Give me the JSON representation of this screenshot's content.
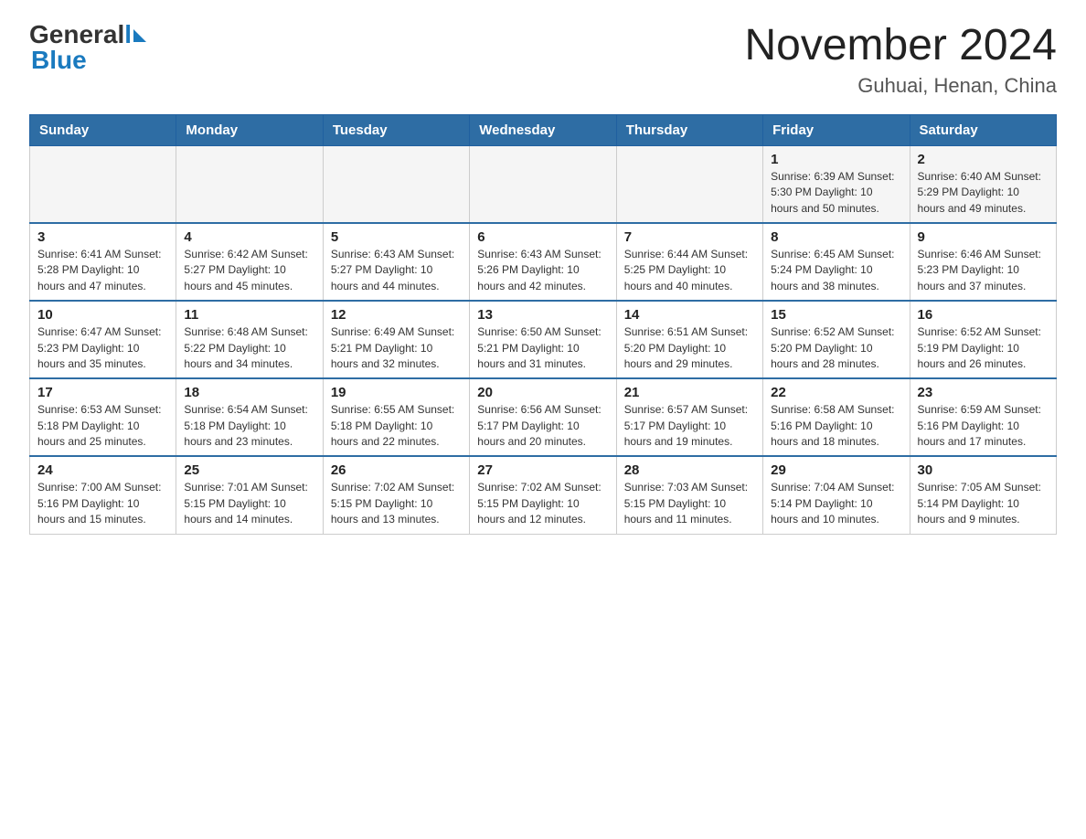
{
  "header": {
    "logo_general": "General",
    "logo_blue": "Blue",
    "title": "November 2024",
    "subtitle": "Guhuai, Henan, China"
  },
  "days_of_week": [
    "Sunday",
    "Monday",
    "Tuesday",
    "Wednesday",
    "Thursday",
    "Friday",
    "Saturday"
  ],
  "weeks": [
    [
      {
        "day": "",
        "info": ""
      },
      {
        "day": "",
        "info": ""
      },
      {
        "day": "",
        "info": ""
      },
      {
        "day": "",
        "info": ""
      },
      {
        "day": "",
        "info": ""
      },
      {
        "day": "1",
        "info": "Sunrise: 6:39 AM\nSunset: 5:30 PM\nDaylight: 10 hours and 50 minutes."
      },
      {
        "day": "2",
        "info": "Sunrise: 6:40 AM\nSunset: 5:29 PM\nDaylight: 10 hours and 49 minutes."
      }
    ],
    [
      {
        "day": "3",
        "info": "Sunrise: 6:41 AM\nSunset: 5:28 PM\nDaylight: 10 hours and 47 minutes."
      },
      {
        "day": "4",
        "info": "Sunrise: 6:42 AM\nSunset: 5:27 PM\nDaylight: 10 hours and 45 minutes."
      },
      {
        "day": "5",
        "info": "Sunrise: 6:43 AM\nSunset: 5:27 PM\nDaylight: 10 hours and 44 minutes."
      },
      {
        "day": "6",
        "info": "Sunrise: 6:43 AM\nSunset: 5:26 PM\nDaylight: 10 hours and 42 minutes."
      },
      {
        "day": "7",
        "info": "Sunrise: 6:44 AM\nSunset: 5:25 PM\nDaylight: 10 hours and 40 minutes."
      },
      {
        "day": "8",
        "info": "Sunrise: 6:45 AM\nSunset: 5:24 PM\nDaylight: 10 hours and 38 minutes."
      },
      {
        "day": "9",
        "info": "Sunrise: 6:46 AM\nSunset: 5:23 PM\nDaylight: 10 hours and 37 minutes."
      }
    ],
    [
      {
        "day": "10",
        "info": "Sunrise: 6:47 AM\nSunset: 5:23 PM\nDaylight: 10 hours and 35 minutes."
      },
      {
        "day": "11",
        "info": "Sunrise: 6:48 AM\nSunset: 5:22 PM\nDaylight: 10 hours and 34 minutes."
      },
      {
        "day": "12",
        "info": "Sunrise: 6:49 AM\nSunset: 5:21 PM\nDaylight: 10 hours and 32 minutes."
      },
      {
        "day": "13",
        "info": "Sunrise: 6:50 AM\nSunset: 5:21 PM\nDaylight: 10 hours and 31 minutes."
      },
      {
        "day": "14",
        "info": "Sunrise: 6:51 AM\nSunset: 5:20 PM\nDaylight: 10 hours and 29 minutes."
      },
      {
        "day": "15",
        "info": "Sunrise: 6:52 AM\nSunset: 5:20 PM\nDaylight: 10 hours and 28 minutes."
      },
      {
        "day": "16",
        "info": "Sunrise: 6:52 AM\nSunset: 5:19 PM\nDaylight: 10 hours and 26 minutes."
      }
    ],
    [
      {
        "day": "17",
        "info": "Sunrise: 6:53 AM\nSunset: 5:18 PM\nDaylight: 10 hours and 25 minutes."
      },
      {
        "day": "18",
        "info": "Sunrise: 6:54 AM\nSunset: 5:18 PM\nDaylight: 10 hours and 23 minutes."
      },
      {
        "day": "19",
        "info": "Sunrise: 6:55 AM\nSunset: 5:18 PM\nDaylight: 10 hours and 22 minutes."
      },
      {
        "day": "20",
        "info": "Sunrise: 6:56 AM\nSunset: 5:17 PM\nDaylight: 10 hours and 20 minutes."
      },
      {
        "day": "21",
        "info": "Sunrise: 6:57 AM\nSunset: 5:17 PM\nDaylight: 10 hours and 19 minutes."
      },
      {
        "day": "22",
        "info": "Sunrise: 6:58 AM\nSunset: 5:16 PM\nDaylight: 10 hours and 18 minutes."
      },
      {
        "day": "23",
        "info": "Sunrise: 6:59 AM\nSunset: 5:16 PM\nDaylight: 10 hours and 17 minutes."
      }
    ],
    [
      {
        "day": "24",
        "info": "Sunrise: 7:00 AM\nSunset: 5:16 PM\nDaylight: 10 hours and 15 minutes."
      },
      {
        "day": "25",
        "info": "Sunrise: 7:01 AM\nSunset: 5:15 PM\nDaylight: 10 hours and 14 minutes."
      },
      {
        "day": "26",
        "info": "Sunrise: 7:02 AM\nSunset: 5:15 PM\nDaylight: 10 hours and 13 minutes."
      },
      {
        "day": "27",
        "info": "Sunrise: 7:02 AM\nSunset: 5:15 PM\nDaylight: 10 hours and 12 minutes."
      },
      {
        "day": "28",
        "info": "Sunrise: 7:03 AM\nSunset: 5:15 PM\nDaylight: 10 hours and 11 minutes."
      },
      {
        "day": "29",
        "info": "Sunrise: 7:04 AM\nSunset: 5:14 PM\nDaylight: 10 hours and 10 minutes."
      },
      {
        "day": "30",
        "info": "Sunrise: 7:05 AM\nSunset: 5:14 PM\nDaylight: 10 hours and 9 minutes."
      }
    ]
  ]
}
